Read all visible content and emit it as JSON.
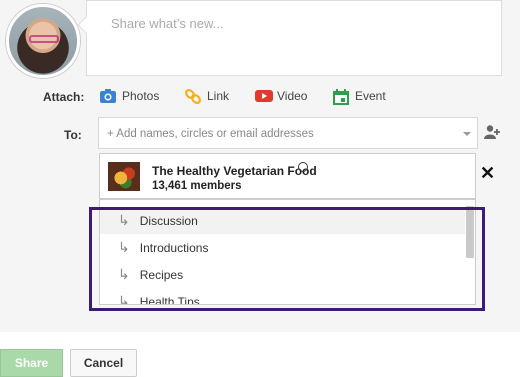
{
  "post": {
    "placeholder": "Share what’s new..."
  },
  "attach": {
    "label": "Attach:",
    "items": [
      {
        "label": "Photos",
        "icon": "camera-icon",
        "color": "#3b82d6"
      },
      {
        "label": "Link",
        "icon": "link-icon",
        "color": "#f2b01e"
      },
      {
        "label": "Video",
        "icon": "video-icon",
        "color": "#e03a2f"
      },
      {
        "label": "Event",
        "icon": "calendar-icon",
        "color": "#2e9e4a"
      }
    ]
  },
  "to": {
    "label": "To:",
    "placeholder": "+ Add names, circles or email addresses"
  },
  "community": {
    "name": "The Healthy Vegetarian Food",
    "members": "13,461 members"
  },
  "categories": [
    "Discussion",
    "Introductions",
    "Recipes",
    "Health Tips"
  ],
  "buttons": {
    "share": "Share",
    "cancel": "Cancel"
  },
  "colors": {
    "highlight_border": "#3c1a7a",
    "share_button": "#a9d8a9"
  }
}
